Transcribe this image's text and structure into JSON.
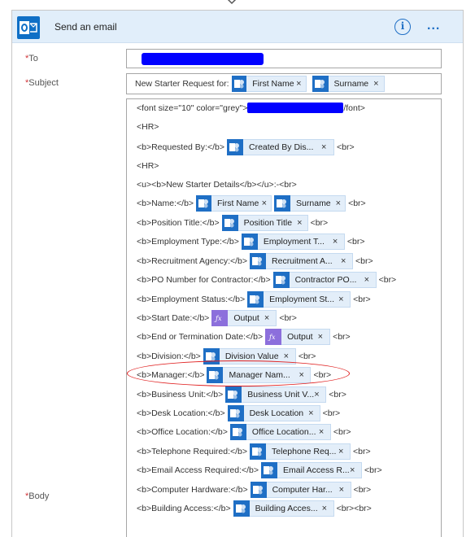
{
  "header": {
    "title": "Send an email",
    "info_glyph": "i",
    "more_glyph": "..."
  },
  "labels": {
    "to": "To",
    "subject": "Subject",
    "body": "Body",
    "required_mark": "*"
  },
  "subject": {
    "prefix": "New Starter Request for:",
    "tokens": [
      "First Name",
      "Surname"
    ]
  },
  "body": {
    "line0_a": "<font size=\"10\" color=\"grey\">",
    "line0_b": "/font>",
    "hr": "<HR>",
    "requested_by": "<b>Requested By:</b>",
    "created_by": "Created By Dis...",
    "br": "<br>",
    "new_starter": "<u><b>New Starter Details</b></u>:-<br>",
    "name": "<b>Name:</b>",
    "first_name": "First Name",
    "surname": "Surname",
    "position_title": "<b>Position Title:</b>",
    "position_title_token": "Position Title",
    "employment_type": "<b>Employment Type:</b>",
    "employment_type_token": "Employment T...",
    "recruitment_agency": "<b>Recruitment Agency:</b>",
    "recruitment_agency_token": "Recruitment A...",
    "po_number": "<b>PO Number for Contractor:</b>",
    "po_number_token": "Contractor PO...",
    "employment_status": "<b>Employment Status:</b>",
    "employment_status_token": "Employment St...",
    "start_date": "<b>Start Date:</b>",
    "output": "Output",
    "end_date": "<b>End or Termination Date:</b>",
    "division": "<b>Division:</b>",
    "division_token": "Division Value",
    "manager": "<b>Manager:</b>",
    "manager_token": "Manager Nam...",
    "business_unit": "<b>Business Unit:</b>",
    "business_unit_token": "Business Unit V...",
    "desk_location": "<b>Desk Location:</b>",
    "desk_location_token": "Desk Location",
    "office_location": "<b>Office Location:</b>",
    "office_location_token": "Office Location...",
    "telephone": "<b>Telephone Required:</b>",
    "telephone_token": "Telephone Req...",
    "email_access": "<b>Email Access Required:</b>",
    "email_access_token": "Email Access R...",
    "computer_hardware": "<b>Computer Hardware:</b>",
    "computer_hardware_token": "Computer Har...",
    "building_access": "<b>Building Access:</b>",
    "building_access_token": "Building Acces...",
    "br_br": "<br><br>"
  },
  "close_glyph": "×",
  "colors": {
    "header_bg": "#e1eefa",
    "accent_blue": "#1f6fc5",
    "token_bg": "#e3eef9",
    "expression_purple": "#8c6fdc",
    "redaction": "#0000ff",
    "annotation_red": "#e02020",
    "required_red": "#d13438"
  },
  "icons": {
    "app": "outlook-icon",
    "info": "info-icon",
    "more": "more-options-icon",
    "sharepoint_token": "sharepoint-icon",
    "expression_token": "expression-fx-icon",
    "connector_arrow": "down-arrow-icon"
  }
}
